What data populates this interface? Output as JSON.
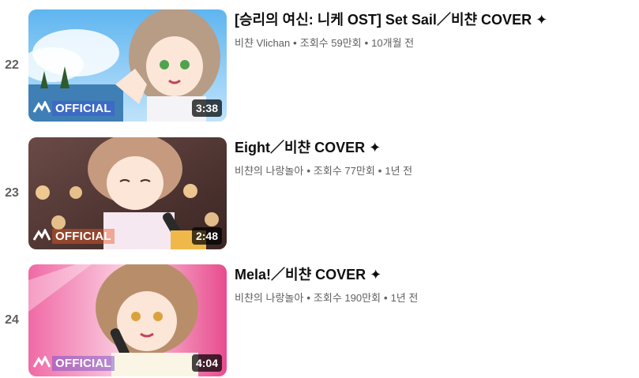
{
  "playlist": {
    "items": [
      {
        "index": "22",
        "title": "[승리의 여신: 니케 OST] Set Sail／비챤 COVER ✦",
        "channel": "비챤 Vlichan",
        "views": "조회수 59만회",
        "age": "10개월 전",
        "duration": "3:38",
        "badge": "OFFICIAL",
        "separator": "•"
      },
      {
        "index": "23",
        "title": "Eight／비챤 COVER ✦",
        "channel": "비챤의 나랑놀아",
        "views": "조회수 77만회",
        "age": "1년 전",
        "duration": "2:48",
        "badge": "OFFICIAL",
        "separator": "•"
      },
      {
        "index": "24",
        "title": "Mela!／비챤 COVER ✦",
        "channel": "비챤의 나랑놀아",
        "views": "조회수 190만회",
        "age": "1년 전",
        "duration": "4:04",
        "badge": "OFFICIAL",
        "separator": "•"
      }
    ]
  },
  "colors": {
    "title": "#0f0f0f",
    "meta": "#606060",
    "duration_bg": "#000000"
  }
}
